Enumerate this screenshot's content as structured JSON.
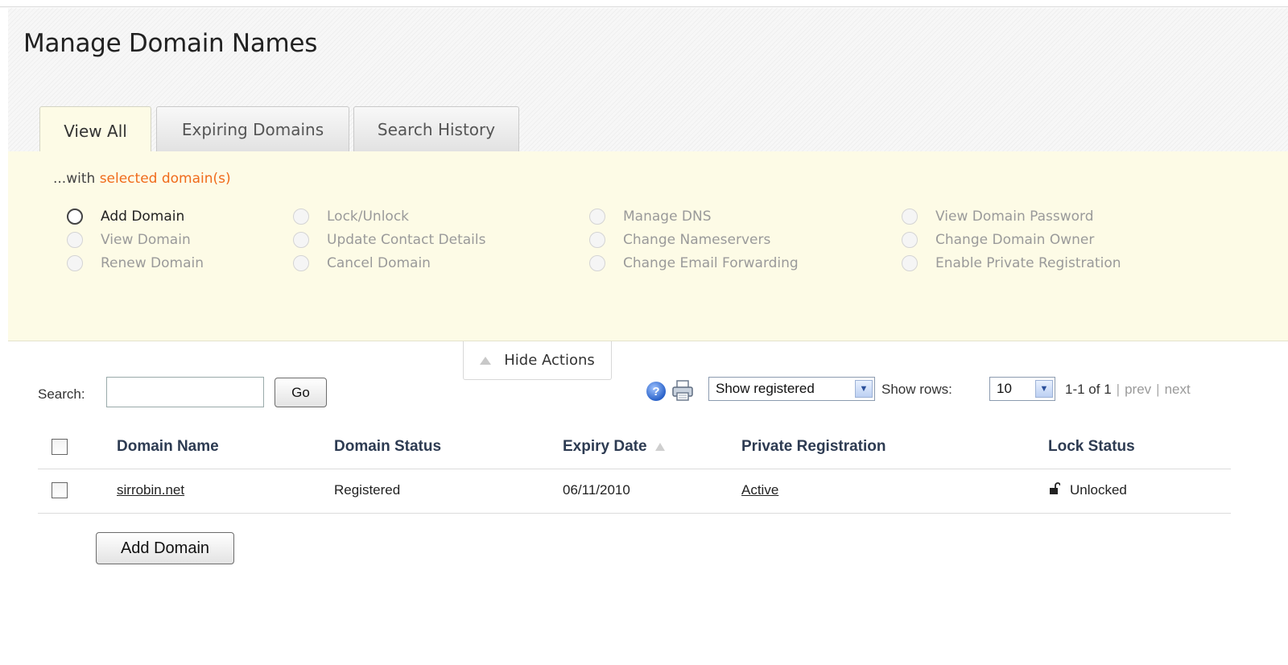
{
  "page": {
    "title": "Manage Domain Names"
  },
  "tabs": [
    {
      "label": "View All",
      "active": true
    },
    {
      "label": "Expiring Domains",
      "active": false
    },
    {
      "label": "Search History",
      "active": false
    }
  ],
  "actions": {
    "with_prefix": "...with",
    "with_highlight": "selected domain(s)",
    "items": [
      {
        "label": "Add Domain",
        "enabled": true
      },
      {
        "label": "View Domain",
        "enabled": false
      },
      {
        "label": "Renew Domain",
        "enabled": false
      },
      {
        "label": "Lock/Unlock",
        "enabled": false
      },
      {
        "label": "Update Contact Details",
        "enabled": false
      },
      {
        "label": "Cancel Domain",
        "enabled": false
      },
      {
        "label": "Manage DNS",
        "enabled": false
      },
      {
        "label": "Change Nameservers",
        "enabled": false
      },
      {
        "label": "Change Email Forwarding",
        "enabled": false
      },
      {
        "label": "View Domain Password",
        "enabled": false
      },
      {
        "label": "Change Domain Owner",
        "enabled": false
      },
      {
        "label": "Enable Private Registration",
        "enabled": false
      }
    ],
    "hide_label": "Hide Actions"
  },
  "toolbar": {
    "search_label": "Search:",
    "search_value": "",
    "go_label": "Go",
    "filter_value": "Show registered",
    "show_rows_label": "Show rows:",
    "rows_value": "10",
    "pager_range": "1-1 of 1",
    "prev_label": "prev",
    "next_label": "next"
  },
  "table": {
    "columns": [
      "Domain Name",
      "Domain Status",
      "Expiry Date",
      "Private Registration",
      "Lock Status"
    ],
    "rows": [
      {
        "domain": "sirrobin.net",
        "status": "Registered",
        "expiry": "06/11/2010",
        "private": "Active",
        "lock": "Unlocked"
      }
    ]
  },
  "footer": {
    "add_domain_label": "Add Domain"
  },
  "icons": {
    "help": "help-icon",
    "print": "printer-icon",
    "lock": "unlocked-padlock-icon",
    "sort": "sort-ascending-icon",
    "collapse": "triangle-up-icon"
  },
  "colors": {
    "accent": "#f06b1b",
    "panel": "#fdfbe6",
    "header_text": "#2d3b52"
  }
}
